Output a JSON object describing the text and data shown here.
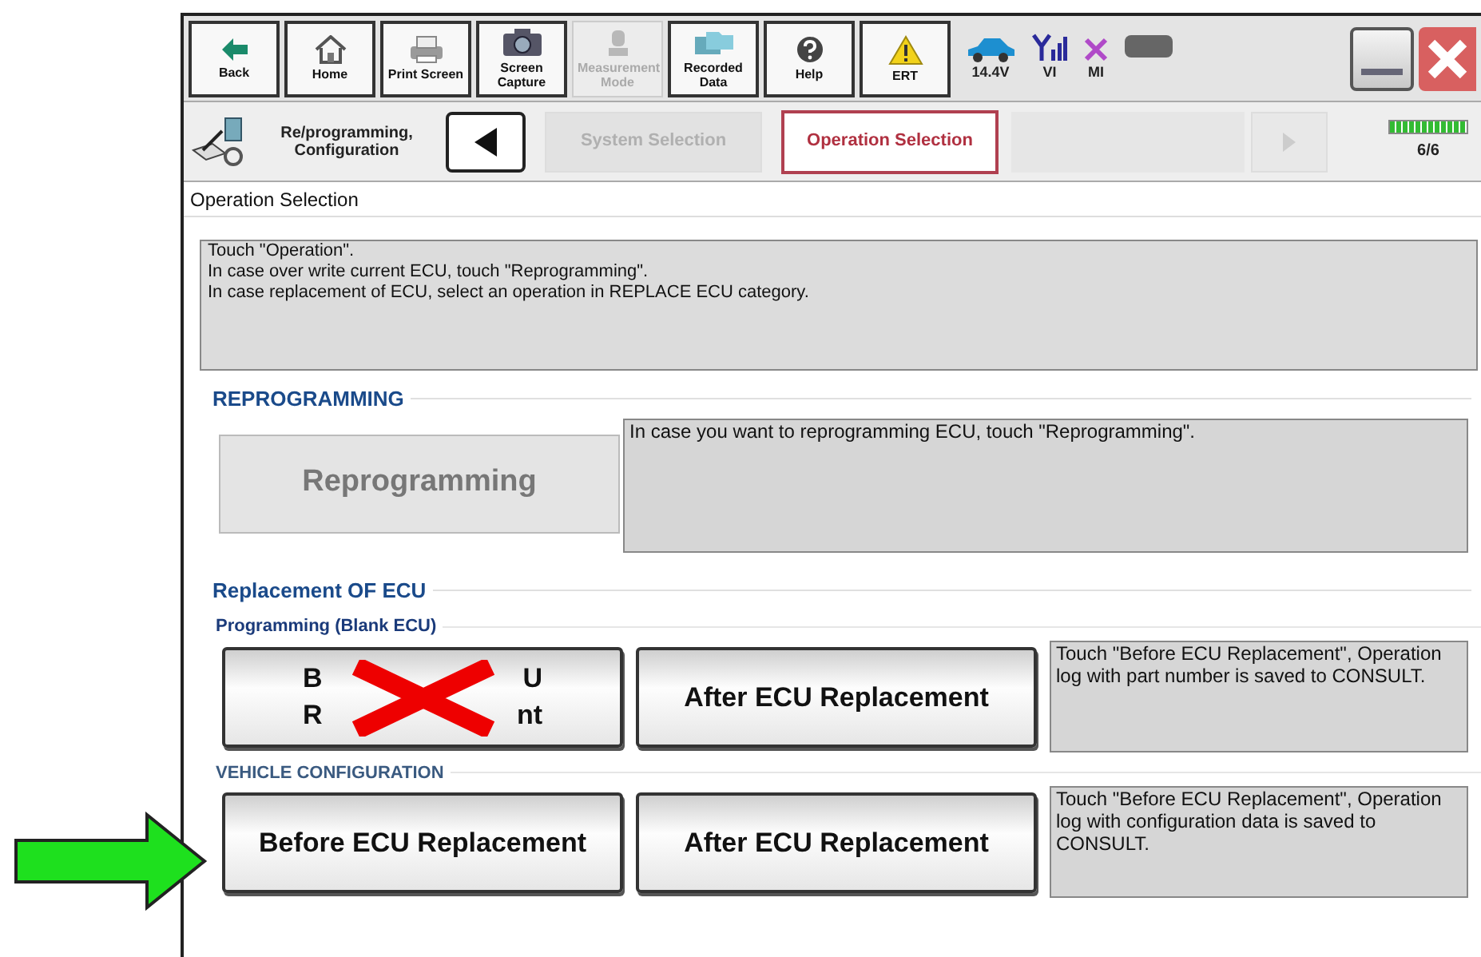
{
  "toolbar": {
    "buttons": [
      {
        "label": "Back",
        "disabled": false
      },
      {
        "label": "Home",
        "disabled": false
      },
      {
        "label": "Print Screen",
        "disabled": false
      },
      {
        "label": "Screen Capture",
        "disabled": false
      },
      {
        "label": "Measurement Mode",
        "disabled": true
      },
      {
        "label": "Recorded Data",
        "disabled": false
      },
      {
        "label": "Help",
        "disabled": false
      },
      {
        "label": "ERT",
        "disabled": false
      }
    ],
    "status": [
      {
        "label": "14.4V"
      },
      {
        "label": "VI"
      },
      {
        "label": "MI"
      }
    ]
  },
  "breadcrumb": {
    "title": "Re/programming, Configuration",
    "steps": [
      {
        "label": "System Selection",
        "selected": false
      },
      {
        "label": "Operation Selection",
        "selected": true
      }
    ],
    "progress": {
      "level": 1,
      "reading": "6/6"
    }
  },
  "page_title": "Operation Selection",
  "instructions": [
    "Touch  \"Operation\".",
    "In case over write current ECU, touch \"Reprogramming\".",
    "In case replacement of ECU, select an operation in REPLACE ECU category."
  ],
  "reprogramming": {
    "heading": "REPROGRAMMING",
    "button": {
      "label": "Reprogramming",
      "disabled": true
    },
    "note": "In case you want to reprogramming ECU, touch \"Reprogramming\"."
  },
  "replacement": {
    "heading": "Replacement OF ECU",
    "groups": [
      {
        "subheading": "Programming (Blank ECU)",
        "pointed": false,
        "buttons": [
          {
            "lines": [
              [
                "B",
                "U"
              ],
              [
                "R",
                "nt"
              ]
            ],
            "crossed_out": true
          },
          {
            "label": "After ECU Replacement",
            "crossed_out": false
          }
        ],
        "note": "Touch \"Before ECU Replacement\", Operation log with part number is saved to CONSULT."
      },
      {
        "subheading": "VEHICLE CONFIGURATION",
        "pointed": true,
        "buttons": [
          {
            "label": "Before ECU Replacement",
            "crossed_out": false
          },
          {
            "label": "After ECU Replacement",
            "crossed_out": false
          }
        ],
        "note": "Touch \"Before ECU Replacement\", Operation log with configuration data is saved to CONSULT."
      }
    ]
  }
}
